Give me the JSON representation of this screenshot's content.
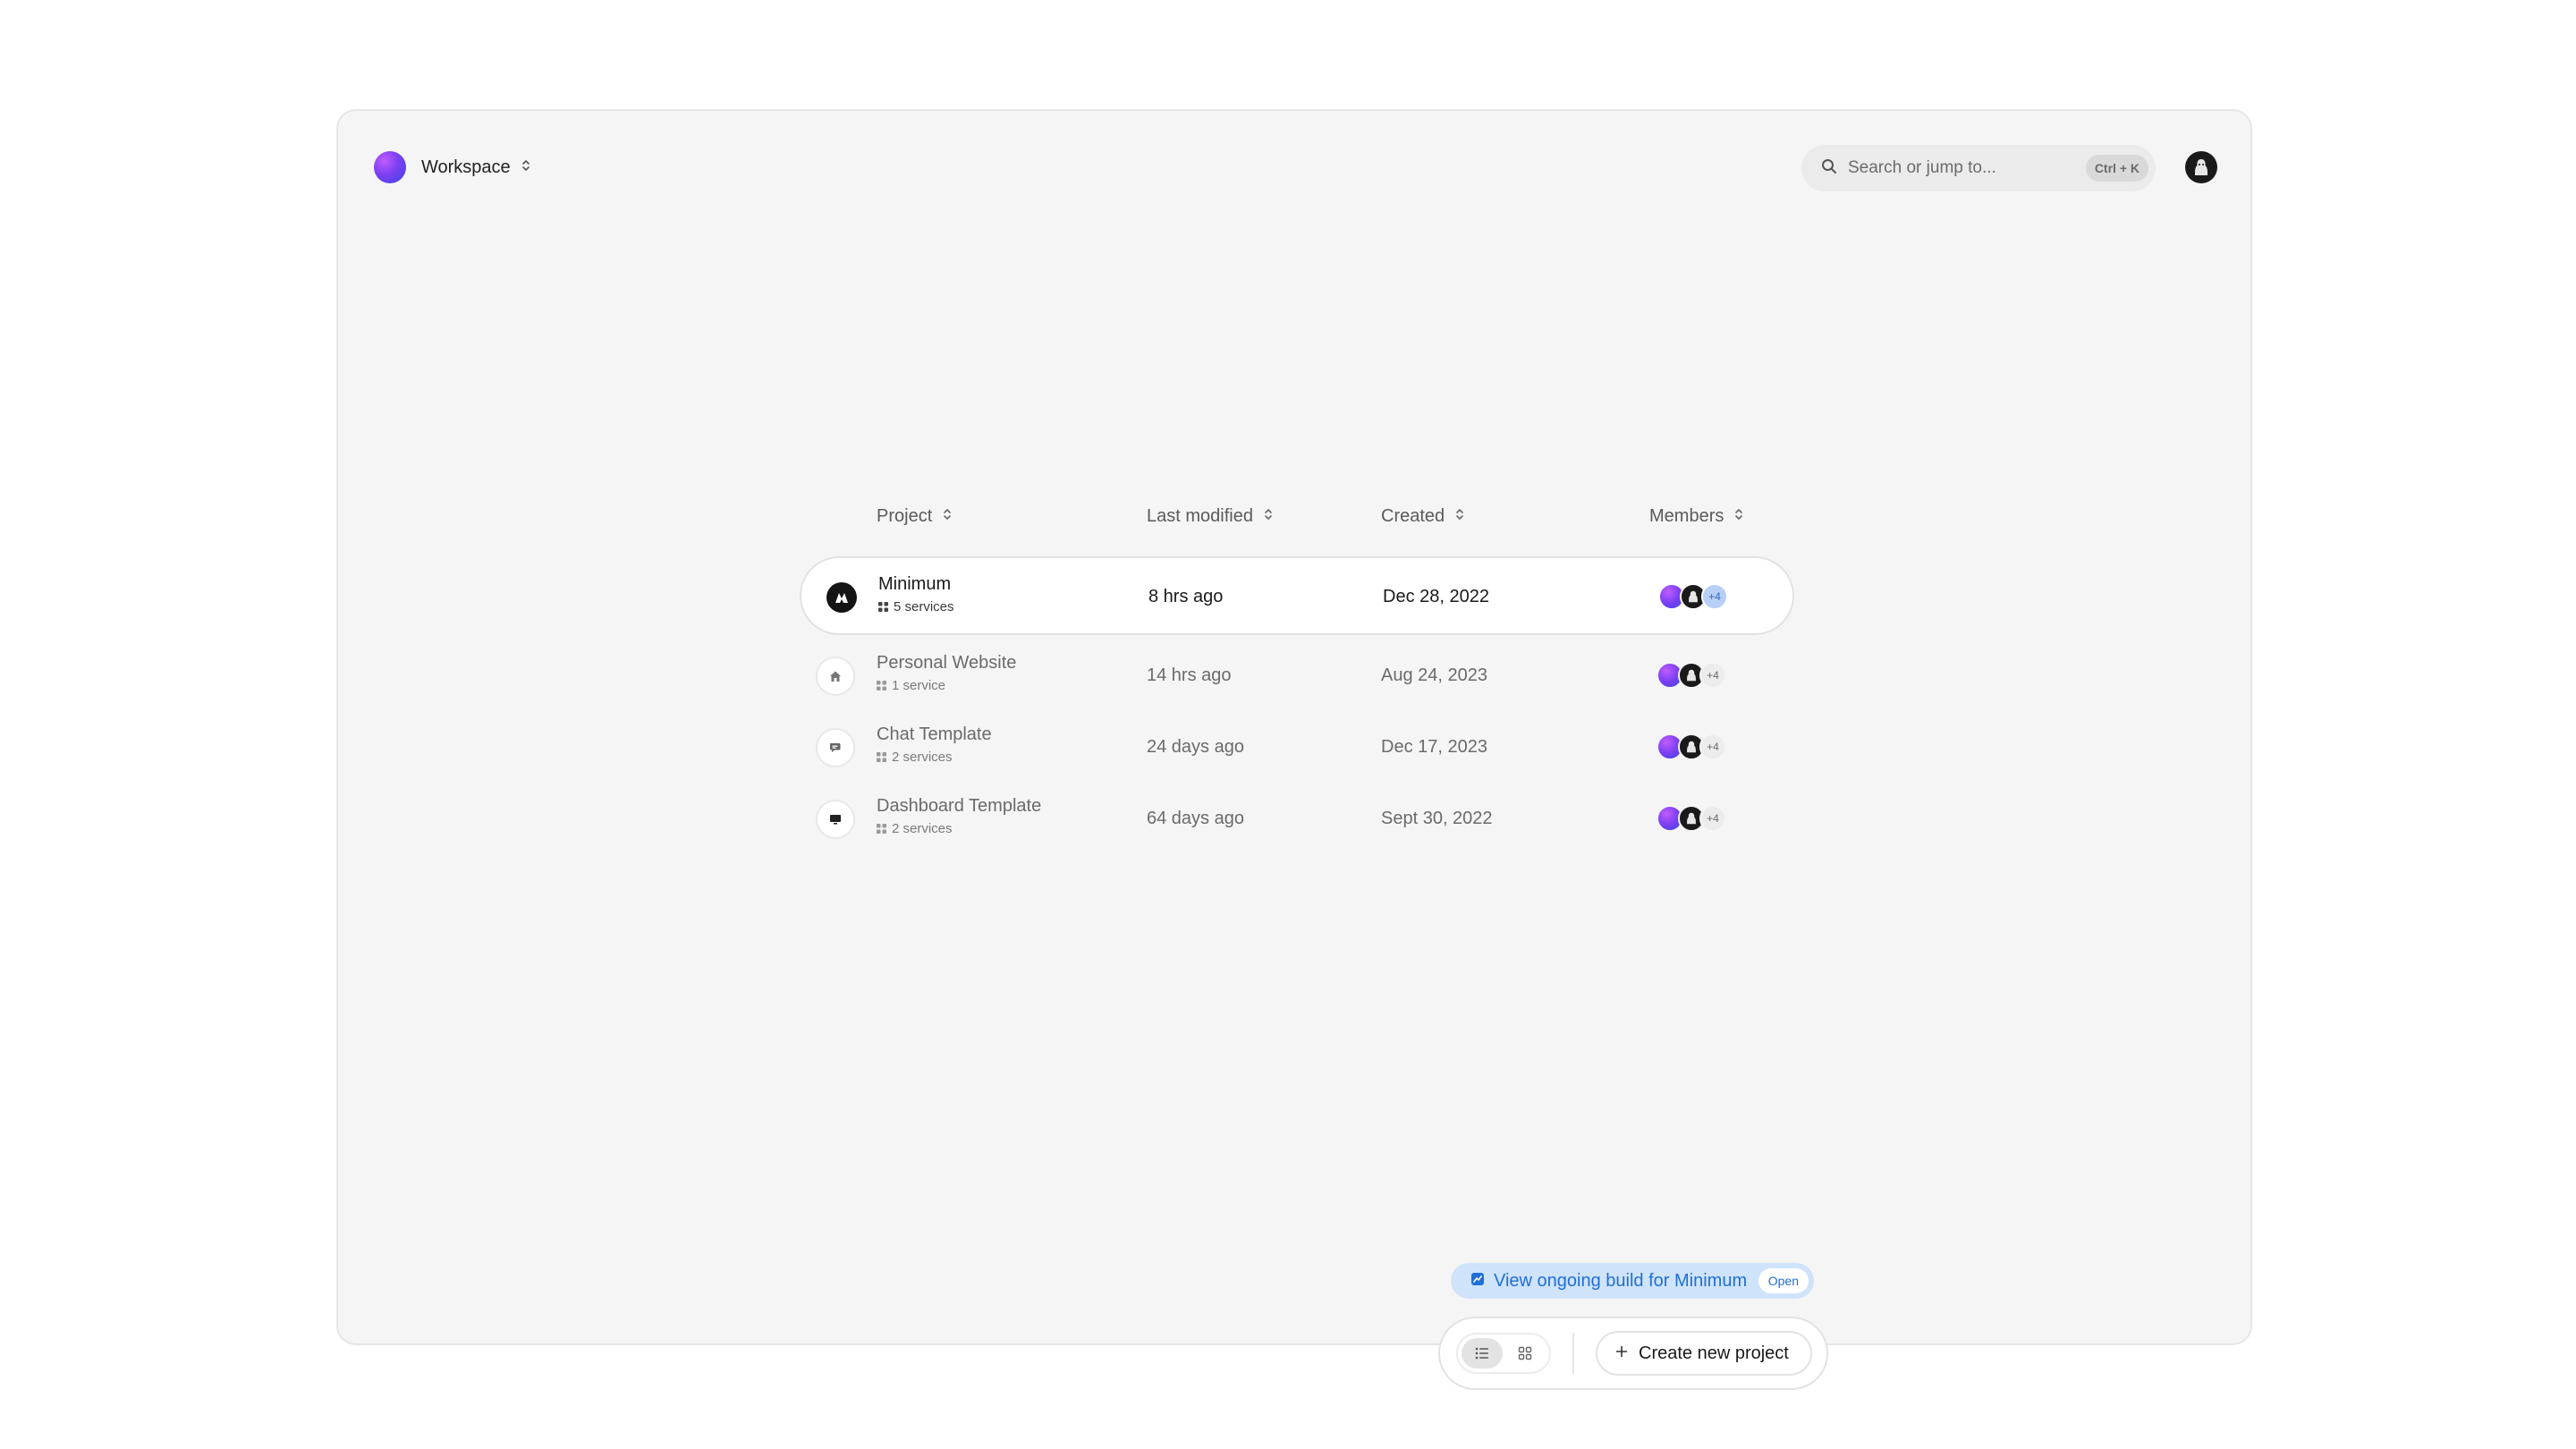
{
  "workspace": {
    "name": "Workspace"
  },
  "search": {
    "placeholder": "Search or jump to...",
    "shortcut": "Ctrl + K"
  },
  "table": {
    "headers": {
      "project": "Project",
      "last_modified": "Last modified",
      "created": "Created",
      "members": "Members"
    },
    "rows": [
      {
        "name": "Minimum",
        "services": "5 services",
        "modified": "8 hrs ago",
        "created": "Dec 28, 2022",
        "extra_members": "+4",
        "icon": "minimum-logo-icon",
        "selected": true
      },
      {
        "name": "Personal Website",
        "services": "1 service",
        "modified": "14 hrs ago",
        "created": "Aug 24, 2023",
        "extra_members": "+4",
        "icon": "home-icon",
        "selected": false
      },
      {
        "name": "Chat Template",
        "services": "2 services",
        "modified": "24 days ago",
        "created": "Dec 17, 2023",
        "extra_members": "+4",
        "icon": "chat-icon",
        "selected": false
      },
      {
        "name": "Dashboard Template",
        "services": "2 services",
        "modified": "64 days ago",
        "created": "Sept 30, 2022",
        "extra_members": "+4",
        "icon": "monitor-icon",
        "selected": false
      }
    ]
  },
  "build_banner": {
    "text": "View ongoing build for Minimum",
    "badge": "Open"
  },
  "dock": {
    "create_label": "Create new project",
    "view_mode": "list"
  },
  "colors": {
    "accent_blue": "#1f6fd6",
    "banner_bg": "#cfe3fb",
    "frame_bg": "#f5f5f5"
  }
}
